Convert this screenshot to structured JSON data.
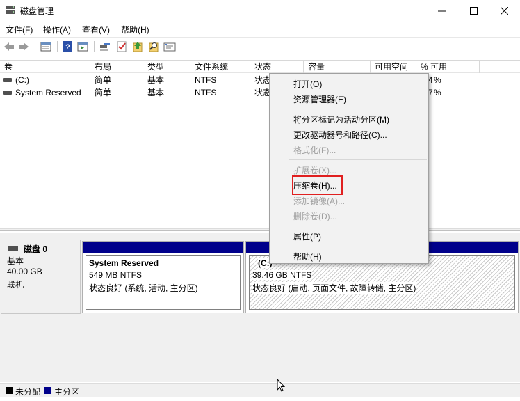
{
  "window": {
    "title": "磁盘管理"
  },
  "menu": [
    "文件(F)",
    "操作(A)",
    "查看(V)",
    "帮助(H)"
  ],
  "toolbar": [
    "back-icon",
    "forward-icon",
    "properties-list-icon",
    "help-icon",
    "console-icon",
    "connect-icon",
    "check-icon",
    "up-icon",
    "search-icon",
    "settings-icon"
  ],
  "columns": [
    "卷",
    "布局",
    "类型",
    "文件系统",
    "状态",
    "容量",
    "可用空间",
    "% 可用"
  ],
  "volumes": [
    {
      "name": "(C:)",
      "layout": "简单",
      "type": "基本",
      "fs": "NTFS",
      "status": "状态",
      "pct": "% "
    },
    {
      "name": "System Reserved",
      "layout": "简单",
      "type": "基本",
      "fs": "NTFS",
      "status": "状态",
      "pct": "% "
    }
  ],
  "volumes_pct_prefix": [
    "4",
    "7"
  ],
  "disk": {
    "name": "磁盘 0",
    "kind": "基本",
    "size": "40.00 GB",
    "state": "联机"
  },
  "partitions": [
    {
      "label": "System Reserved",
      "size": "549 MB NTFS",
      "status": "状态良好 (系统, 活动, 主分区)"
    },
    {
      "label": "(C:)",
      "size": "39.46 GB NTFS",
      "status": "状态良好 (启动, 页面文件, 故障转储, 主分区)"
    }
  ],
  "legend": [
    {
      "label": "未分配",
      "color": "#000000"
    },
    {
      "label": "主分区",
      "color": "#00008b"
    }
  ],
  "context_menu": {
    "open": "打开(O)",
    "explore": "资源管理器(E)",
    "mark_active": "将分区标记为活动分区(M)",
    "change_letter": "更改驱动器号和路径(C)...",
    "format": "格式化(F)...",
    "extend": "扩展卷(X)...",
    "shrink": "压缩卷(H)...",
    "add_mirror": "添加镜像(A)...",
    "delete": "删除卷(D)...",
    "properties": "属性(P)",
    "help": "帮助(H)"
  }
}
